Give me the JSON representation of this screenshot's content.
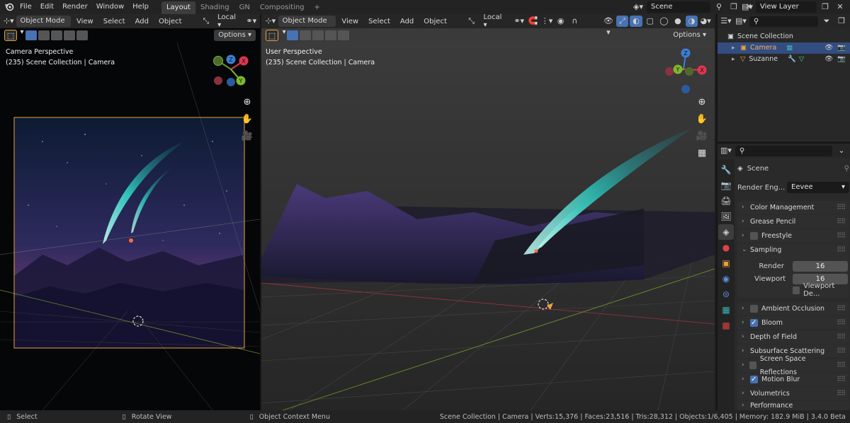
{
  "topbar": {
    "menus": [
      "File",
      "Edit",
      "Render",
      "Window",
      "Help"
    ],
    "workspaces": [
      "Layout",
      "Shading",
      "GN",
      "Compositing"
    ],
    "active_workspace": "Layout",
    "add_tab": "+",
    "scene_name": "Scene",
    "view_layer": "View Layer"
  },
  "viewport_left": {
    "mode": "Object Mode",
    "menus": [
      "View",
      "Select",
      "Add",
      "Object"
    ],
    "transform": "Local",
    "options": "Options",
    "perspective": "Camera Perspective",
    "collection": "(235) Scene Collection | Camera"
  },
  "viewport_right": {
    "mode": "Object Mode",
    "menus": [
      "View",
      "Select",
      "Add",
      "Object"
    ],
    "transform": "Local",
    "options": "Options",
    "perspective": "User Perspective",
    "collection": "(235) Scene Collection | Camera"
  },
  "gizmo": {
    "x": "X",
    "y": "Y",
    "z": "Z"
  },
  "outliner": {
    "root": "Scene Collection",
    "items": [
      {
        "name": "Camera",
        "selected": true
      },
      {
        "name": "Suzanne",
        "selected": false
      }
    ]
  },
  "properties": {
    "context": "Scene",
    "render_engine_label": "Render Eng...",
    "render_engine": "Eevee",
    "panels": [
      {
        "label": "Color Management",
        "checkbox": null,
        "expanded": false
      },
      {
        "label": "Grease Pencil",
        "checkbox": null,
        "expanded": false
      },
      {
        "label": "Freestyle",
        "checkbox": false,
        "expanded": false
      },
      {
        "label": "Sampling",
        "checkbox": null,
        "expanded": true
      }
    ],
    "sampling": {
      "render_label": "Render",
      "render_value": "16",
      "viewport_label": "Viewport",
      "viewport_value": "16",
      "viewport_denoise_label": "Viewport De..."
    },
    "panels_after": [
      {
        "label": "Ambient Occlusion",
        "checkbox": false
      },
      {
        "label": "Bloom",
        "checkbox": true
      },
      {
        "label": "Depth of Field",
        "checkbox": null
      },
      {
        "label": "Subsurface Scattering",
        "checkbox": null
      },
      {
        "label": "Screen Space Reflections",
        "checkbox": false
      },
      {
        "label": "Motion Blur",
        "checkbox": true
      },
      {
        "label": "Volumetrics",
        "checkbox": null
      },
      {
        "label": "Performance",
        "checkbox": null
      }
    ]
  },
  "statusbar": {
    "select": "Select",
    "rotate": "Rotate View",
    "context_menu": "Object Context Menu",
    "stats": "Scene Collection | Camera | Verts:15,376 | Faces:23,516 | Tris:28,312 | Objects:1/6,405 | Memory: 182.9 MiB | 3.4.0 Beta"
  },
  "colors": {
    "accent": "#4772b3",
    "x_axis": "#e0354f",
    "y_axis": "#7fb82b",
    "z_axis": "#3b7fd6",
    "camera_frame": "#e8a33a"
  }
}
